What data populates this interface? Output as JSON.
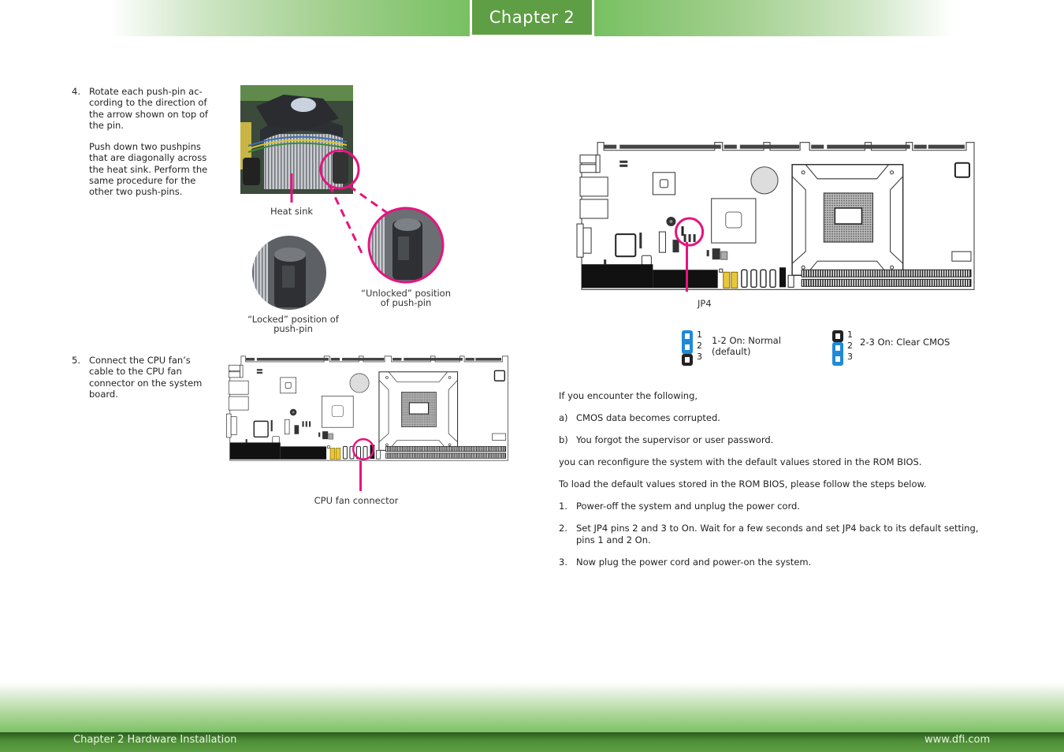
{
  "header": {
    "chapter_label": "Chapter 2"
  },
  "footer": {
    "left": "Chapter 2 Hardware Installation",
    "right": "www.dfi.com"
  },
  "colors": {
    "accent_green": "#5e9e44",
    "highlight_magenta": "#e5147f",
    "jumper_blue": "#1f8ad6"
  },
  "steps_left": [
    {
      "number": "4.",
      "lines": [
        "Rotate each push-pin ac-",
        "cording to the direction of",
        "the arrow shown on top of",
        "the pin."
      ],
      "lines2": [
        "Push down two pushpins",
        "that are diagonally across",
        "the heat sink. Perform the",
        "same procedure for the",
        "other two push-pins."
      ]
    },
    {
      "number": "5.",
      "lines": [
        "Connect the CPU fan’s",
        "cable to the CPU fan",
        "connector on the system",
        "board."
      ]
    }
  ],
  "figure_heatsink": {
    "label_heat_sink": "Heat sink",
    "label_unlocked_1": "“Unlocked” position",
    "label_unlocked_2": "of push-pin",
    "label_locked_1": "“Locked” position of",
    "label_locked_2": "push-pin"
  },
  "figure_fan": {
    "label": "CPU fan connector"
  },
  "figure_jp4": {
    "label": "JP4",
    "settings": [
      {
        "pins": [
          "1",
          "2",
          "3"
        ],
        "on": "1-2",
        "label_1": "1-2 On: Normal",
        "label_2": "(default)"
      },
      {
        "pins": [
          "1",
          "2",
          "3"
        ],
        "on": "2-3",
        "label_1": "2-3 On: Clear CMOS",
        "label_2": ""
      }
    ]
  },
  "cmos_text": {
    "intro": "If you encounter the following,",
    "conditions": [
      {
        "marker": "a)",
        "text": "CMOS data becomes corrupted."
      },
      {
        "marker": "b)",
        "text": "You forgot the supervisor or user password."
      }
    ],
    "reconfigure": "you can reconfigure the system with the default values stored in the ROM BIOS.",
    "steps_intro": "To load the default values stored in the ROM BIOS, please follow the steps below.",
    "steps": [
      {
        "marker": "1.",
        "text": "Power-off the system and unplug the power cord."
      },
      {
        "marker": "2.",
        "text": "Set JP4 pins 2 and 3 to On. Wait for a few seconds and set JP4 back to its default setting,",
        "text2": "pins 1 and 2 On."
      },
      {
        "marker": "3.",
        "text": "Now plug the power cord and power-on the system."
      }
    ]
  }
}
